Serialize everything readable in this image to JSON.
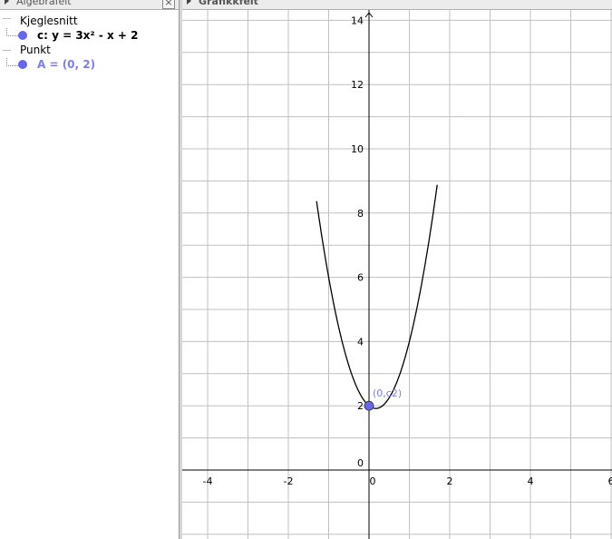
{
  "algebra": {
    "title": "Algebrafelt",
    "close_icon": "close-icon",
    "categories": [
      {
        "label": "Kjeglesnitt",
        "items": [
          {
            "text": "c: y = 3x² - x + 2",
            "color": "#000000"
          }
        ]
      },
      {
        "label": "Punkt",
        "items": [
          {
            "text": "A = (0, 2)",
            "color": "#7d7deb"
          }
        ]
      }
    ]
  },
  "graphics": {
    "title": "Grafikkfelt",
    "x_ticks": [
      "-4",
      "-2",
      "0",
      "2",
      "4",
      "6"
    ],
    "y_ticks": [
      "0",
      "2",
      "4",
      "6",
      "8",
      "10",
      "12",
      "14"
    ],
    "curve": {
      "equation": "y = 3x² - x + 2",
      "a": 3,
      "b": -1,
      "c": 2,
      "color": "#000000"
    },
    "point": {
      "name": "A",
      "x": 0,
      "y": 2,
      "label": "(0,c2)",
      "color": "#6666ee"
    }
  }
}
